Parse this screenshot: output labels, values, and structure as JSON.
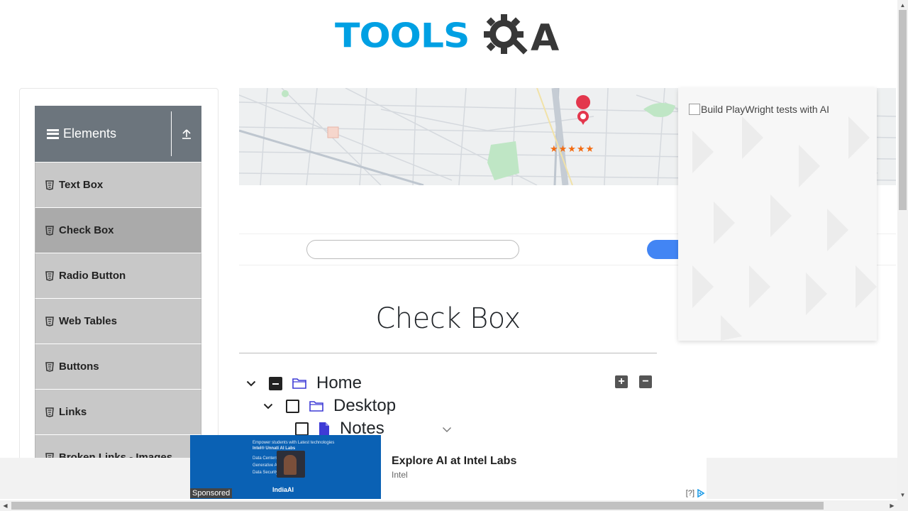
{
  "logo": {
    "text": "TOOLS",
    "suffix": "A"
  },
  "sidebar": {
    "group_title": "Elements",
    "items": [
      {
        "label": "Text Box"
      },
      {
        "label": "Check Box"
      },
      {
        "label": "Radio Button"
      },
      {
        "label": "Web Tables"
      },
      {
        "label": "Buttons"
      },
      {
        "label": "Links"
      },
      {
        "label": "Broken Links - Images"
      }
    ],
    "active_index": 1
  },
  "map_ad": {
    "rating_stars": "★★★★★"
  },
  "right_ad": {
    "alt_text": "Build PlayWright tests with AI"
  },
  "main": {
    "title": "Check Box",
    "tree": [
      {
        "label": "Home",
        "level": 0,
        "state": "partial",
        "type": "folder",
        "expanded": true
      },
      {
        "label": "Desktop",
        "level": 1,
        "state": "unchecked",
        "type": "folder",
        "expanded": true
      },
      {
        "label": "Notes",
        "level": 2,
        "state": "unchecked",
        "type": "file"
      }
    ],
    "expand_all": "+",
    "collapse_all": "−"
  },
  "bottom_ad": {
    "headline": "Explore AI at Intel Labs",
    "brand": "Intel",
    "sponsored": "Sponsored",
    "tag": "[?]",
    "image_lines": [
      "Empower students with Latest technologies",
      "Intel® Unnati AI Labs",
      "Data Centers",
      "Generative AI",
      "Data Security",
      "IndiaAI"
    ]
  },
  "colors": {
    "accent": "#00a0e3",
    "sidebar_header": "#6c757d",
    "menu_bg": "#c8c8c8",
    "menu_active": "#aaaaaa"
  }
}
